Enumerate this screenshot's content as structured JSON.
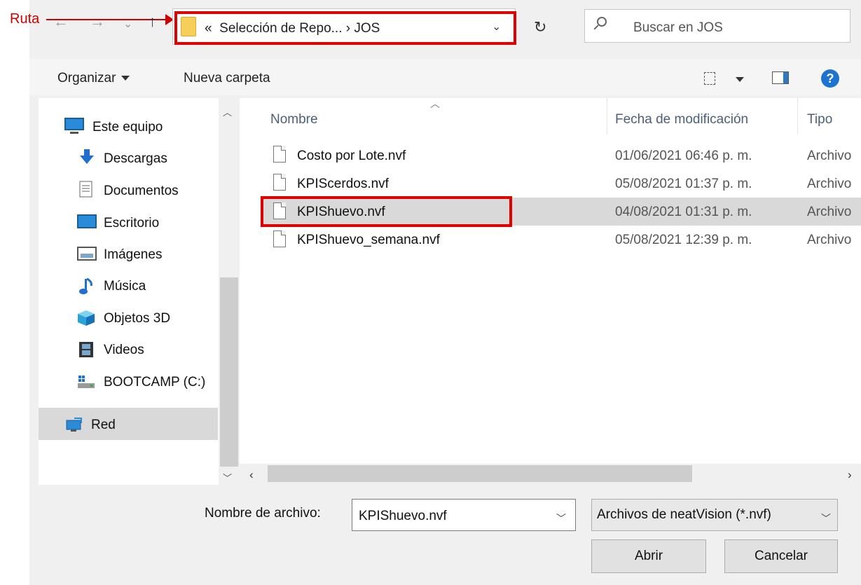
{
  "annotation": {
    "label": "Ruta"
  },
  "nav": {
    "back": "←",
    "forward": "→",
    "recent": "⌄",
    "up": "↑"
  },
  "address": {
    "prefix": "«",
    "path": "Selección de Repo...  ›  JOS",
    "chevron": "⌄",
    "refresh": "↻"
  },
  "search": {
    "placeholder": "Buscar en JOS"
  },
  "toolbar": {
    "organize": "Organizar",
    "new_folder": "Nueva carpeta",
    "help": "?"
  },
  "sidebar": {
    "items": [
      {
        "label": "Este equipo",
        "icon": "monitor-icon"
      },
      {
        "label": "Descargas",
        "icon": "download-icon"
      },
      {
        "label": "Documentos",
        "icon": "document-icon"
      },
      {
        "label": "Escritorio",
        "icon": "desktop-icon"
      },
      {
        "label": "Imágenes",
        "icon": "image-icon"
      },
      {
        "label": "Música",
        "icon": "music-icon"
      },
      {
        "label": "Objetos 3D",
        "icon": "cube-icon"
      },
      {
        "label": "Videos",
        "icon": "film-icon"
      },
      {
        "label": "BOOTCAMP (C:)",
        "icon": "drive-icon"
      },
      {
        "label": "Red",
        "icon": "network-icon"
      }
    ],
    "selected": "Red"
  },
  "columns": {
    "name": "Nombre",
    "date": "Fecha de modificación",
    "type": "Tipo"
  },
  "files": [
    {
      "name": "Costo por Lote.nvf",
      "date": "01/06/2021 06:46 p. m.",
      "type": "Archivo"
    },
    {
      "name": "KPIScerdos.nvf",
      "date": "05/08/2021 01:37 p. m.",
      "type": "Archivo"
    },
    {
      "name": "KPIShuevo.nvf",
      "date": "04/08/2021 01:31 p. m.",
      "type": "Archivo"
    },
    {
      "name": "KPIShuevo_semana.nvf",
      "date": "05/08/2021 12:39 p. m.",
      "type": "Archivo"
    }
  ],
  "selected_file": "KPIShuevo.nvf",
  "bottom": {
    "filename_label": "Nombre de archivo:",
    "filename_value": "KPIShuevo.nvf",
    "filter_value": "Archivos de neatVision (*.nvf)",
    "open_button": "Abrir",
    "cancel_button": "Cancelar"
  },
  "colors": {
    "annotation": "#e00000",
    "selection": "#d9d9d9",
    "help": "#1e73d1",
    "folder": "#f5cf5a"
  }
}
